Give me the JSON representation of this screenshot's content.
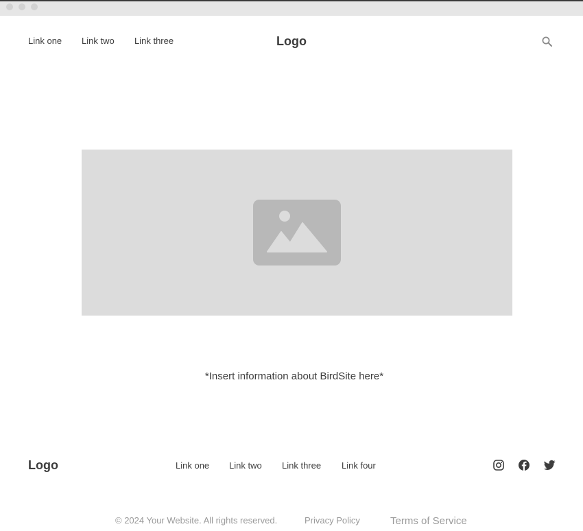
{
  "header": {
    "nav": [
      {
        "label": "Link one"
      },
      {
        "label": "Link two"
      },
      {
        "label": "Link three"
      }
    ],
    "logo": "Logo",
    "search_icon": "search-icon"
  },
  "hero": {
    "image_icon": "image-placeholder-icon"
  },
  "main": {
    "info": "*Insert information about BirdSite here*"
  },
  "footer": {
    "logo": "Logo",
    "links": [
      {
        "label": "Link one"
      },
      {
        "label": "Link two"
      },
      {
        "label": "Link three"
      },
      {
        "label": "Link four"
      }
    ],
    "social": [
      "instagram-icon",
      "facebook-icon",
      "twitter-icon"
    ],
    "copyright": "© 2024 Your Website. All rights reserved.",
    "privacy": "Privacy Policy",
    "terms": "Terms of Service"
  },
  "colors": {
    "text": "#3d3d3d",
    "muted": "#9a9a9a",
    "placeholder_bg": "#dcdcdc",
    "placeholder_icon": "#b8b8b8"
  }
}
